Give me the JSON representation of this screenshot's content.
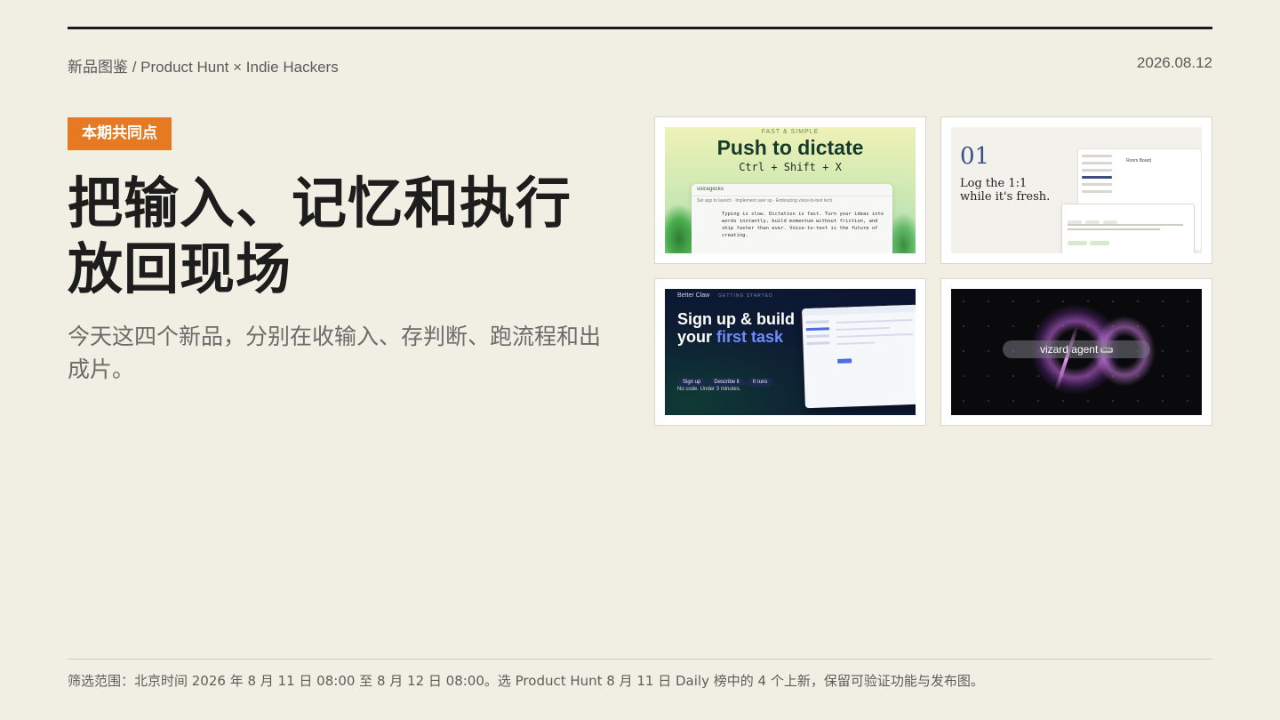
{
  "header": {
    "breadcrumb": "新品图鉴 / Product Hunt × Indie Hackers",
    "date": "2026.08.12"
  },
  "hero": {
    "tag": "本期共同点",
    "headline": "把输入、记忆和执行放回现场",
    "subline": "今天这四个新品，分别在收输入、存判断、跑流程和出成片。"
  },
  "cards": [
    {
      "kicker": "FAST & SIMPLE",
      "title": "Push to dictate",
      "keys": "Ctrl + Shift + X",
      "app_name": "voicegecko",
      "toolbar": "Set app to launch  ·  Implement user sp  ·  Embracing voice-to-text tech",
      "body": "Typing is slow. Dictation is fast. Turn your ideas into words instantly, build momentum without friction, and ship faster than ever. Voice-to-text is the future of creating."
    },
    {
      "number": "01",
      "title_line1": "Log the 1:1",
      "title_line2": "while it's fresh.",
      "panel_heading": "Room Board"
    },
    {
      "brand": "Better Claw",
      "tagline": "GETTING STARTED",
      "headline_line1": "Sign up & build",
      "headline_prefix": "your ",
      "headline_highlight": "first task",
      "steps": [
        "Sign up",
        "Describe it",
        "It runs"
      ],
      "footnote": "No code. Under 3 minutes."
    },
    {
      "logo_text": "vizard agent",
      "badge": "beta"
    }
  ],
  "footer": {
    "note": "筛选范围：北京时间 2026 年 8 月 11 日 08:00 至 8 月 12 日 08:00。选 Product Hunt 8 月 11 日 Daily 榜中的 4 个上新，保留可验证功能与发布图。"
  },
  "colors": {
    "background": "#f1efe4",
    "accent": "#e57a23",
    "rule": "#1c1c1c"
  }
}
